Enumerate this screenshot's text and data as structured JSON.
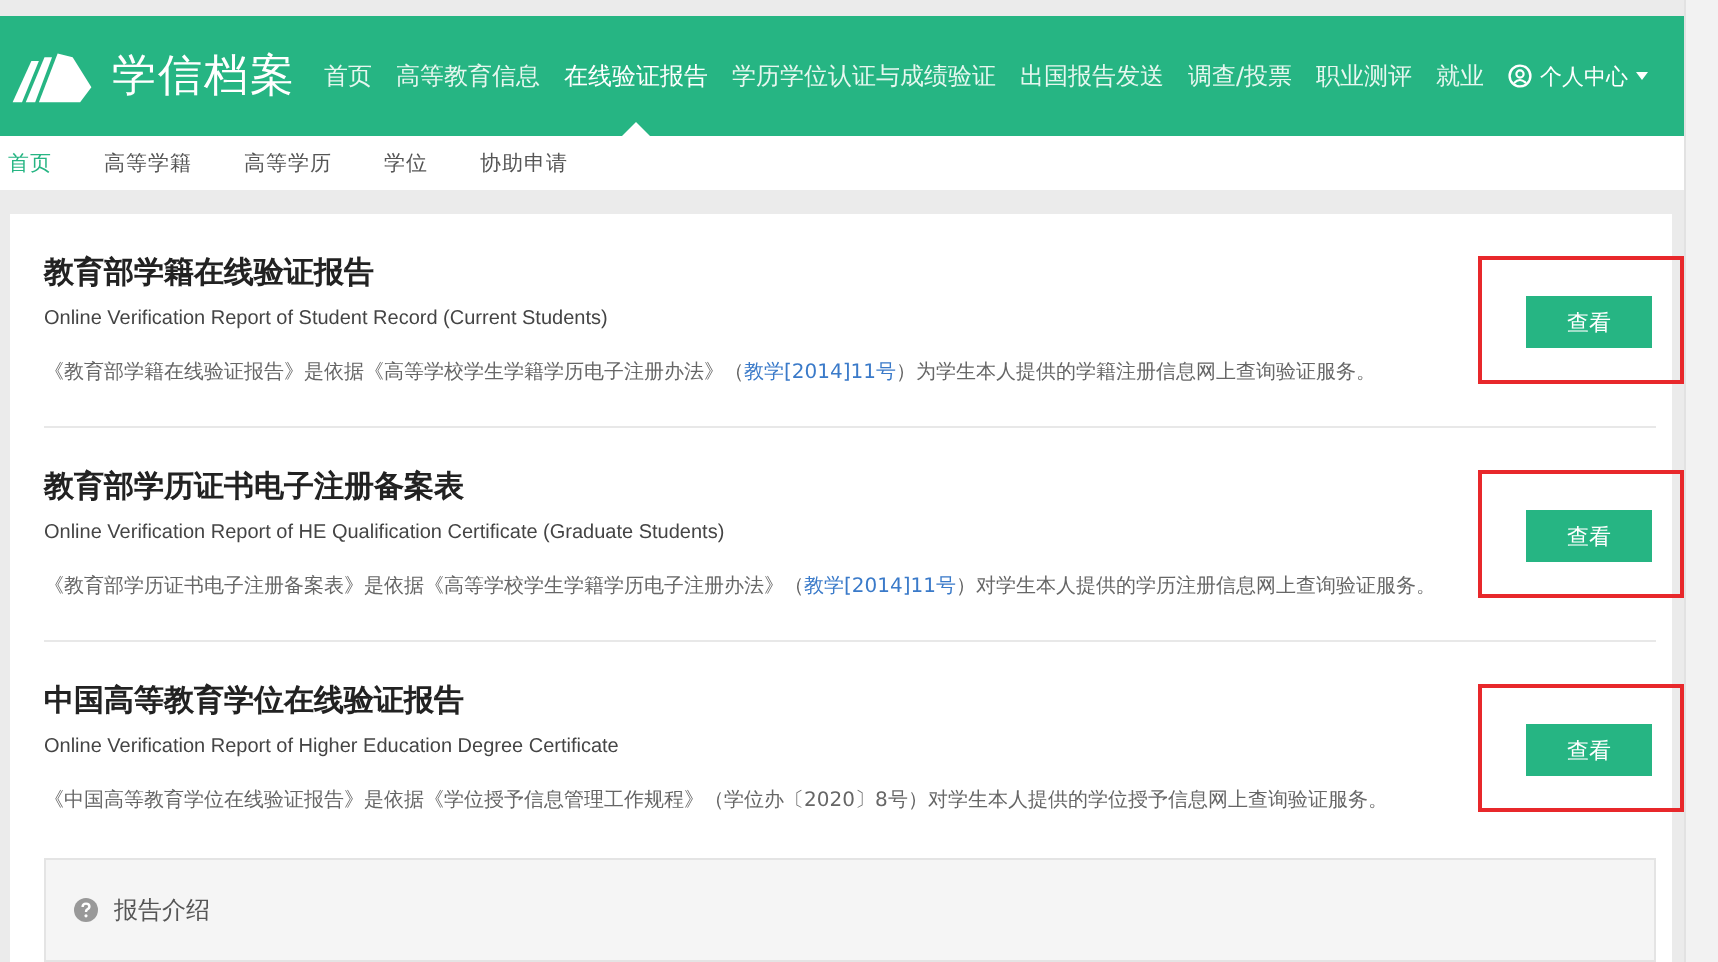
{
  "header": {
    "logo_text": "学信档案",
    "nav": [
      {
        "label": "首页",
        "selected": false
      },
      {
        "label": "高等教育信息",
        "selected": false
      },
      {
        "label": "在线验证报告",
        "selected": true
      },
      {
        "label": "学历学位认证与成绩验证",
        "selected": false
      },
      {
        "label": "出国报告发送",
        "selected": false
      },
      {
        "label": "调查/投票",
        "selected": false
      },
      {
        "label": "职业测评",
        "selected": false
      },
      {
        "label": "就业",
        "selected": false
      }
    ],
    "user_menu": "个人中心"
  },
  "subnav": [
    {
      "label": "首页",
      "selected": true
    },
    {
      "label": "高等学籍",
      "selected": false
    },
    {
      "label": "高等学历",
      "selected": false
    },
    {
      "label": "学位",
      "selected": false
    },
    {
      "label": "协助申请",
      "selected": false
    }
  ],
  "reports": [
    {
      "title": "教育部学籍在线验证报告",
      "subtitle": "Online Verification Report of Student Record (Current Students)",
      "description": {
        "before": "《教育部学籍在线验证报告》是依据《高等学校学生学籍学历电子注册办法》（",
        "link": "教学[2014]11号",
        "after": "）为学生本人提供的学籍注册信息网上查询验证服务。"
      },
      "button": "查看",
      "highlighted": true
    },
    {
      "title": "教育部学历证书电子注册备案表",
      "subtitle": "Online Verification Report of HE Qualification Certificate (Graduate Students)",
      "description": {
        "before": "《教育部学历证书电子注册备案表》是依据《高等学校学生学籍学历电子注册办法》（",
        "link": "教学[2014]11号",
        "after": "）对学生本人提供的学历注册信息网上查询验证服务。"
      },
      "button": "查看",
      "highlighted": true
    },
    {
      "title": "中国高等教育学位在线验证报告",
      "subtitle": "Online Verification Report of Higher Education Degree Certificate",
      "description": {
        "before": "《中国高等教育学位在线验证报告》是依据《学位授予信息管理工作规程》（学位办〔2020〕8号）对学生本人提供的学位授予信息网上查询验证服务。"
      },
      "button": "查看",
      "highlighted": true
    }
  ],
  "intro_panel": {
    "title": "报告介绍"
  }
}
